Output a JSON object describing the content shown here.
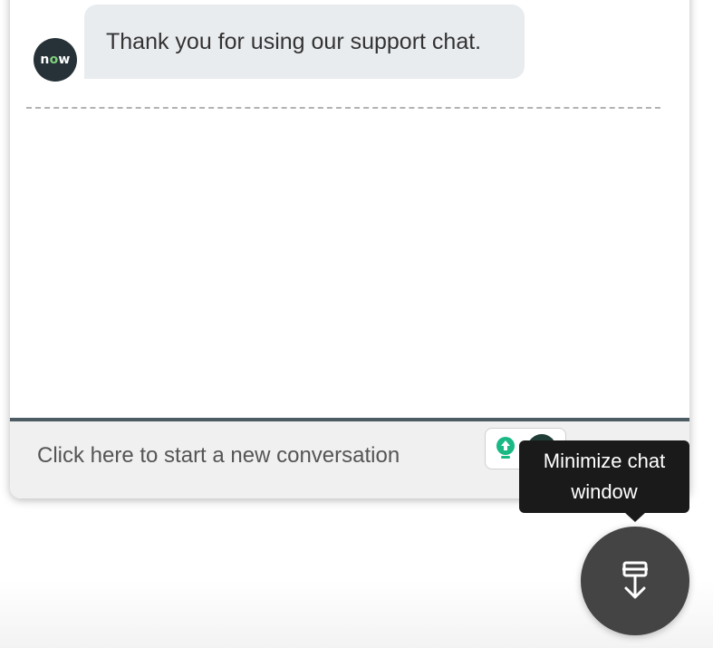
{
  "chat": {
    "avatar_text": "now",
    "messages": [
      {
        "sender": "agent",
        "text": "Thank you for using our support chat."
      }
    ]
  },
  "composer": {
    "label": "Click here to start a new conversation"
  },
  "minimize": {
    "tooltip": "Minimize chat window",
    "icon": "minimize-download-icon"
  },
  "colors": {
    "avatar_bg": "#263238",
    "avatar_accent": "#7fd17c",
    "bubble_bg": "#e9ecef",
    "fab_bg": "#444444",
    "tooltip_bg": "#1a1a1a",
    "composer_border": "#4d5b62"
  }
}
